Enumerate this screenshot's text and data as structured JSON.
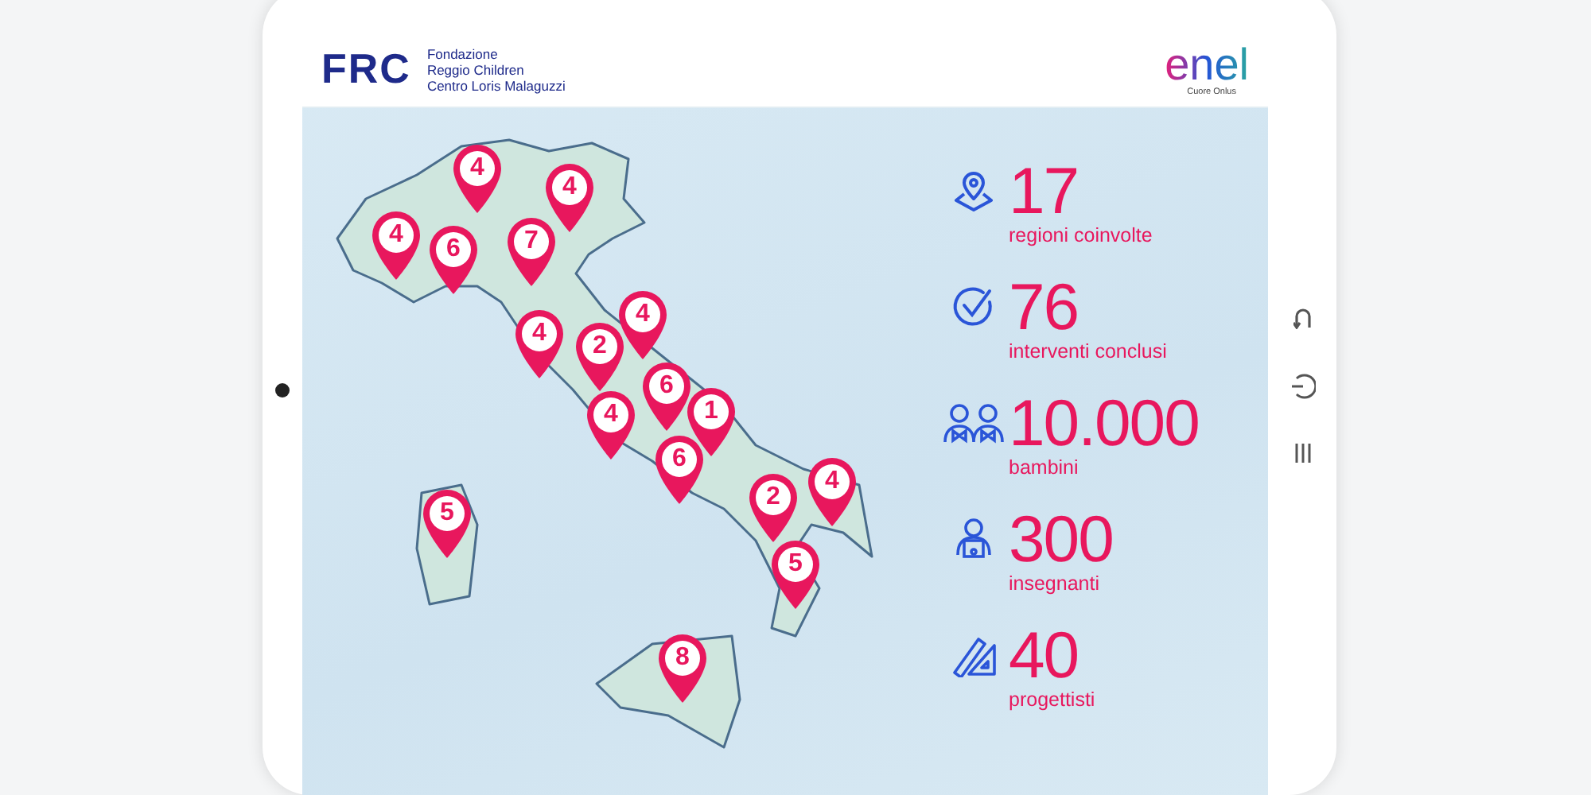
{
  "header": {
    "org_logo": "FRC",
    "org_name": [
      "Fondazione",
      "Reggio Children",
      "Centro Loris Malaguzzi"
    ],
    "sponsor_logo": "enel",
    "sponsor_subtitle": "Cuore Onlus"
  },
  "map": {
    "pins": [
      {
        "count": "4"
      },
      {
        "count": "4"
      },
      {
        "count": "4"
      },
      {
        "count": "6"
      },
      {
        "count": "7"
      },
      {
        "count": "4"
      },
      {
        "count": "2"
      },
      {
        "count": "4"
      },
      {
        "count": "6"
      },
      {
        "count": "1"
      },
      {
        "count": "4"
      },
      {
        "count": "6"
      },
      {
        "count": "2"
      },
      {
        "count": "4"
      },
      {
        "count": "5"
      },
      {
        "count": "5"
      },
      {
        "count": "8"
      }
    ]
  },
  "stats": [
    {
      "kind": "regions",
      "value": "17",
      "label": "regioni coinvolte"
    },
    {
      "kind": "check",
      "value": "76",
      "label": "interventi conclusi"
    },
    {
      "kind": "children",
      "value": "10.000",
      "label": "bambini"
    },
    {
      "kind": "teacher",
      "value": "300",
      "label": "insegnanti"
    },
    {
      "kind": "design",
      "value": "40",
      "label": "progettisti"
    }
  ]
}
